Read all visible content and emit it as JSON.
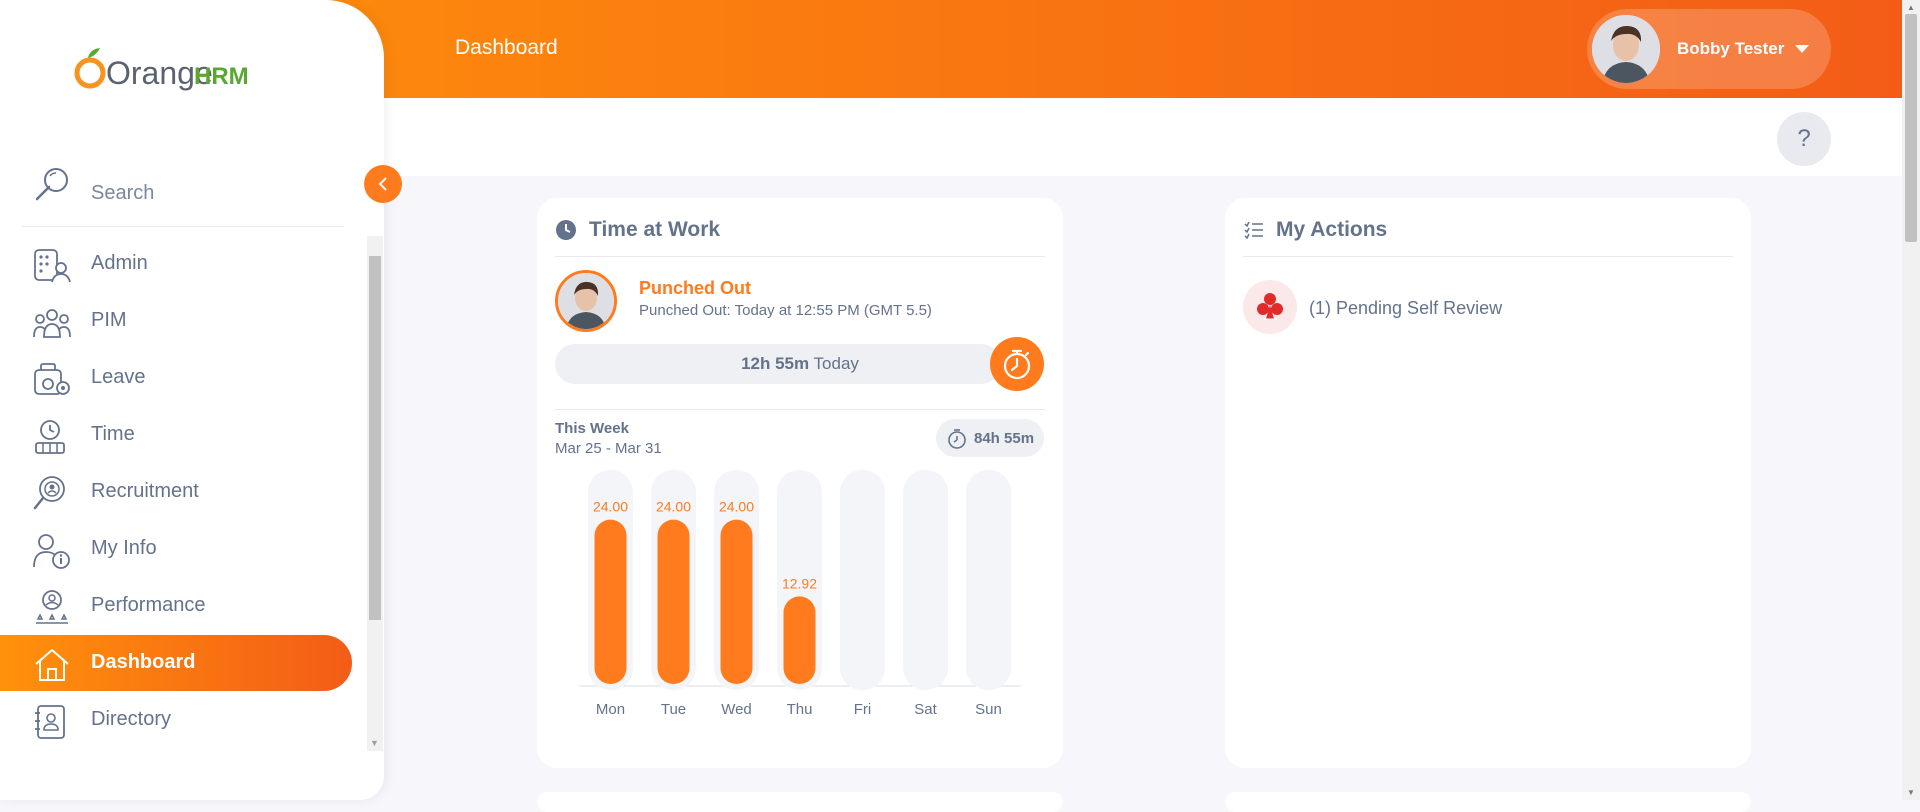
{
  "app": {
    "logo_text_1": "Orange",
    "logo_text_2": "HRM"
  },
  "header": {
    "page_title": "Dashboard",
    "user_name": "Bobby Tester",
    "help_label": "?"
  },
  "sidebar": {
    "search_label": "Search",
    "items": [
      {
        "label": "Admin",
        "icon": "admin-icon",
        "active": false
      },
      {
        "label": "PIM",
        "icon": "pim-icon",
        "active": false
      },
      {
        "label": "Leave",
        "icon": "leave-icon",
        "active": false
      },
      {
        "label": "Time",
        "icon": "time-icon",
        "active": false
      },
      {
        "label": "Recruitment",
        "icon": "recruitment-icon",
        "active": false
      },
      {
        "label": "My Info",
        "icon": "my-info-icon",
        "active": false
      },
      {
        "label": "Performance",
        "icon": "performance-icon",
        "active": false
      },
      {
        "label": "Dashboard",
        "icon": "home-icon",
        "active": true
      },
      {
        "label": "Directory",
        "icon": "directory-icon",
        "active": false
      }
    ]
  },
  "time_at_work": {
    "title": "Time at Work",
    "status": "Punched Out",
    "status_detail": "Punched Out: Today at 12:55 PM (GMT 5.5)",
    "today_hours": "12h 55m",
    "today_label": "Today",
    "week_label": "This Week",
    "week_range": "Mar 25 - Mar 31",
    "week_total": "84h 55m"
  },
  "my_actions": {
    "title": "My Actions",
    "items": [
      {
        "label": "(1) Pending Self Review",
        "icon": "self-review-icon"
      }
    ]
  },
  "colors": {
    "accent": "#ff7b1d",
    "accent_dark": "#f35c17",
    "text": "#64728c",
    "track": "#f4f5f9"
  },
  "chart_data": {
    "type": "bar",
    "categories": [
      "Mon",
      "Tue",
      "Wed",
      "Thu",
      "Fri",
      "Sat",
      "Sun"
    ],
    "values": [
      24.0,
      24.0,
      24.0,
      12.92,
      null,
      null,
      null
    ],
    "value_labels": [
      "24.00",
      "24.00",
      "24.00",
      "12.92",
      "",
      "",
      ""
    ],
    "title": "",
    "xlabel": "",
    "ylabel": "",
    "ylim": [
      0,
      30
    ],
    "grid": false
  }
}
